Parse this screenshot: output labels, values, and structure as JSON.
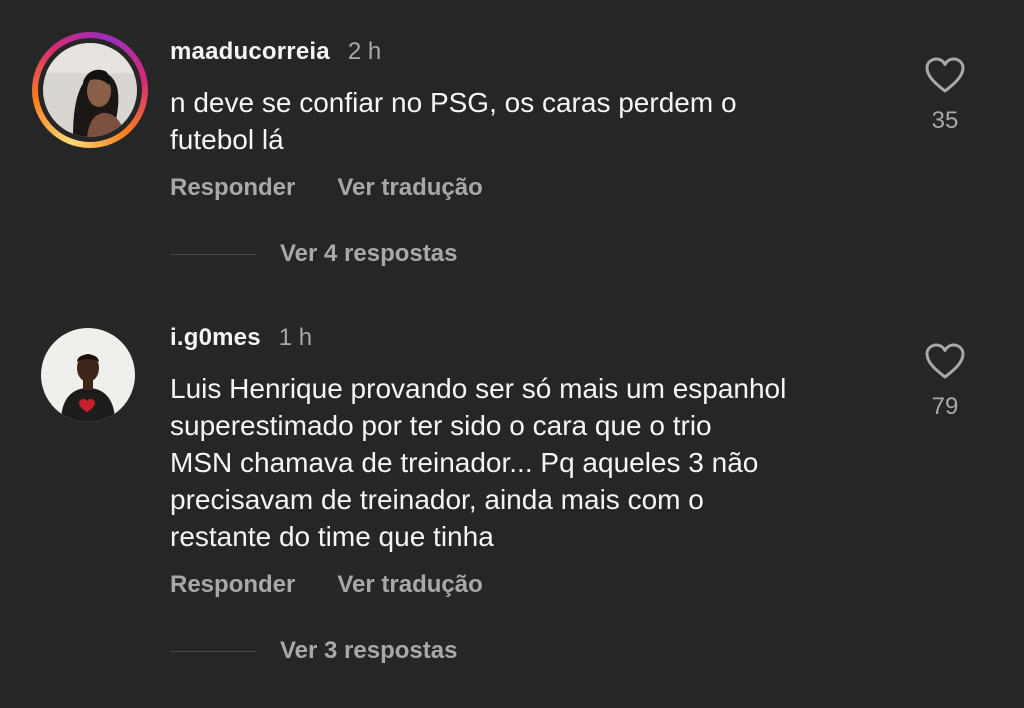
{
  "comments": [
    {
      "username": "maaducorreia",
      "time": "2 h",
      "text_lines": [
        "n deve se confiar no PSG, os caras perdem o",
        "futebol lá"
      ],
      "likes": "35",
      "reply_label": "Responder",
      "translate_label": "Ver tradução",
      "view_replies": "Ver 4 respostas",
      "avatar_story_ring": true
    },
    {
      "username": "i.g0mes",
      "time": "1 h",
      "text_lines": [
        "Luis Henrique provando ser só mais um espanhol",
        "superestimado por ter sido o cara que o trio",
        "MSN chamava de treinador... Pq aqueles 3 não",
        "precisavam de treinador, ainda mais com o",
        "restante do time que tinha"
      ],
      "likes": "79",
      "reply_label": "Responder",
      "translate_label": "Ver tradução",
      "view_replies": "Ver 3 respostas",
      "avatar_story_ring": false
    }
  ],
  "icons": {
    "like": "heart-outline-icon"
  },
  "colors": {
    "background": "#262626",
    "primary_text": "#f5f5f5",
    "secondary_text": "#a8a8a8"
  }
}
